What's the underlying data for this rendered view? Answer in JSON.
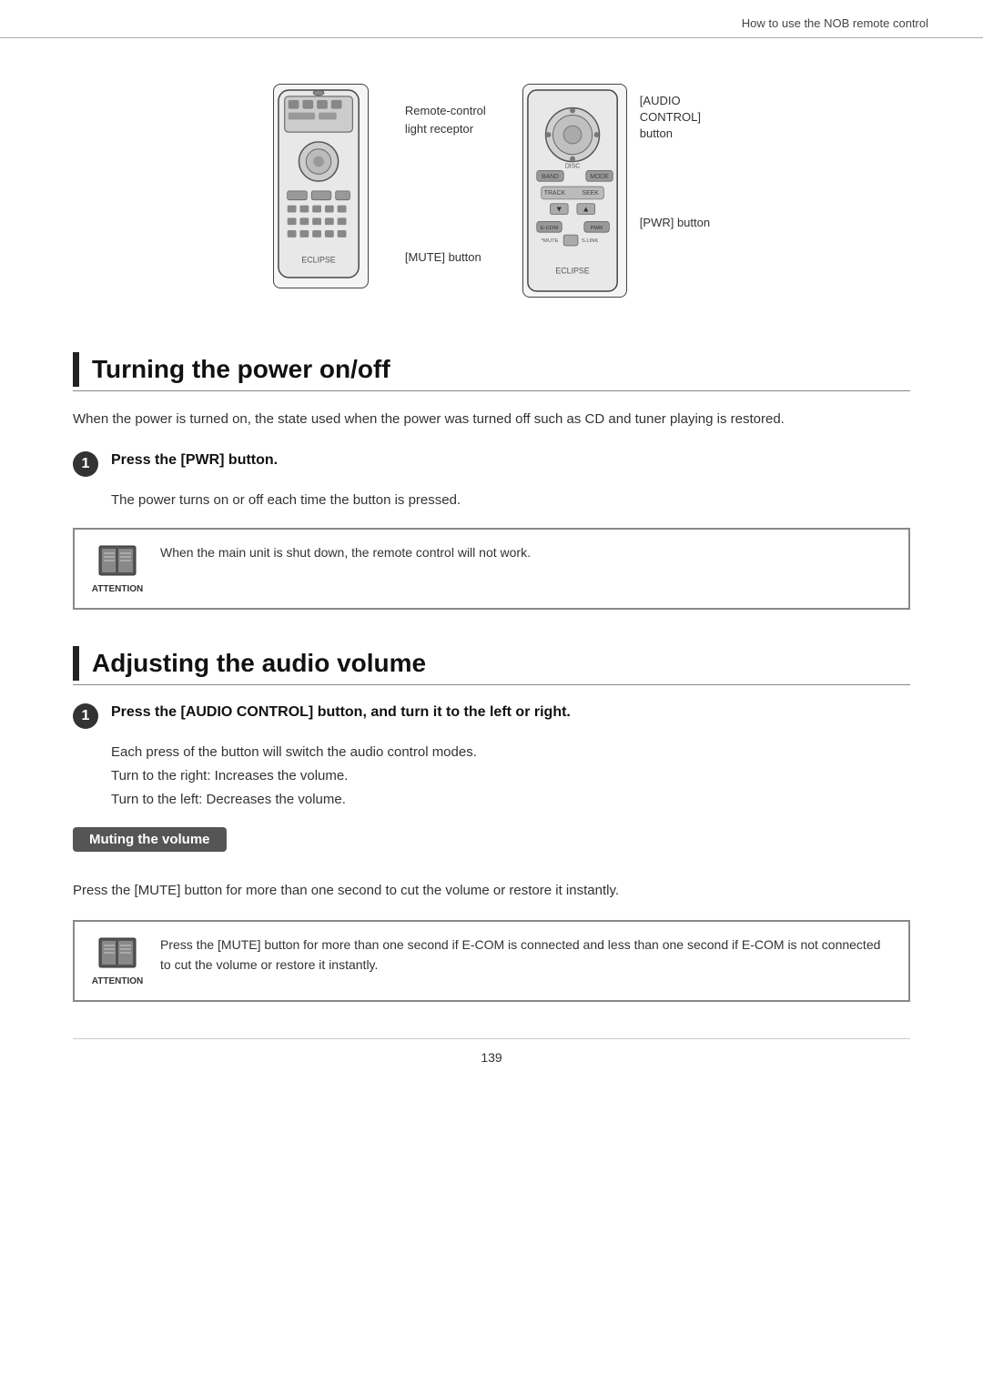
{
  "header": {
    "title": "How to use the NOB remote control"
  },
  "diagram": {
    "left_label_1": "Remote-control",
    "left_label_2": "light receptor",
    "mute_label": "[MUTE] button",
    "pwr_label": "[PWR] button",
    "audio_control_label_1": "[AUDIO",
    "audio_control_label_2": "CONTROL]",
    "audio_control_label_3": "button"
  },
  "sections": [
    {
      "id": "power",
      "title": "Turning the power on/off",
      "description": "When the power is turned on, the state used when the power was turned off such as CD and tuner playing is restored.",
      "steps": [
        {
          "number": "1",
          "text": "Press the [PWR] button.",
          "desc": "The power turns on or off each time the button is pressed."
        }
      ],
      "attention": {
        "text": "When the main unit is shut down, the remote control will not work."
      }
    },
    {
      "id": "audio",
      "title": "Adjusting the audio volume",
      "steps": [
        {
          "number": "1",
          "text": "Press the [AUDIO CONTROL] button, and turn it to the left or right.",
          "desc_lines": [
            "Each press of the button will switch the audio control modes.",
            "Turn to the right:  Increases the volume.",
            "Turn to the left:    Decreases the volume."
          ]
        }
      ],
      "sub_section": {
        "badge": "Muting the volume",
        "desc": "Press the [MUTE] button for more than one second to cut the volume or restore it instantly."
      },
      "attention": {
        "text": "Press the [MUTE] button for more than one second if E-COM is connected and less than one second if E-COM is not connected to cut the volume or restore it instantly."
      }
    }
  ],
  "page_number": "139"
}
